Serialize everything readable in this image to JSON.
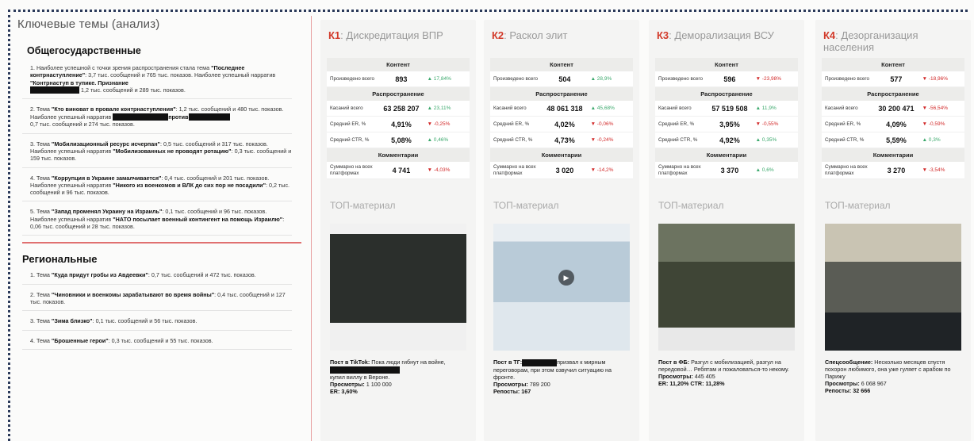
{
  "left": {
    "title": "Ключевые темы (анализ)",
    "section1": "Общегосударственные",
    "items1": [
      {
        "pre": "1. Наиболее успешной с точки зрения распространения стала тема ",
        "theme": "\"Последнее контрнаступление\"",
        "post": ": 3,7 тыс. сообщений и 765 тыс. показов. Наиболее успешный нарратив ",
        "narr": "\"Контрнаступ в тупике. Признание",
        "tail": "1,2 тыс. сообщений и 289 тыс. показов."
      },
      {
        "pre": "2. Тема ",
        "theme": "\"Кто виноват в провале контрнаступления\"",
        "post": ": 1,2 тыс. сообщений и 480 тыс. показов. Наиболее успешный нарратив ",
        "narr": "против",
        "tail": "0,7 тыс. сообщений и 274 тыс. показов."
      },
      {
        "pre": "3. Тема ",
        "theme": "\"Мобилизационный ресурс исчерпан\"",
        "post": ": 0,5 тыс. сообщений и 317 тыс. показов. Наиболее успешный нарратив ",
        "narr": "\"Мобилизованных не проводят ротацию\"",
        "tail": ": 0,3 тыс. сообщений и 159 тыс. показов."
      },
      {
        "pre": "4. Тема ",
        "theme": "\"Коррупция в Украине замалчивается\"",
        "post": ": 0,4 тыс. сообщений и 201 тыс. показов. Наиболее успешный нарратив ",
        "narr": "\"Никого из военкомов и ВЛК до сих пор не посадили\"",
        "tail": ": 0,2 тыс. сообщений и 96 тыс. показов."
      },
      {
        "pre": "5. Тема ",
        "theme": "\"Запад променял Украину на Израиль\"",
        "post": ": 0,1 тыс. сообщений и 96 тыс. показов. Наиболее успешный нарратив ",
        "narr": "\"НАТО посылает военный контингент на помощь Израилю\"",
        "tail": ": 0,06 тыс. сообщений и 28 тыс. показов."
      }
    ],
    "section2": "Региональные",
    "items2": [
      {
        "pre": "1. Тема ",
        "theme": "\"Куда придут гробы из Авдеевки\"",
        "post": ": 0,7 тыс. сообщений и 472 тыс. показов."
      },
      {
        "pre": "2. Тема ",
        "theme": "\"Чиновники и военкомы зарабатывают во время войны\"",
        "post": ": 0,4 тыс. сообщений и 127 тыс. показов."
      },
      {
        "pre": "3. Тема ",
        "theme": "\"Зима близко\"",
        "post": ": 0,1 тыс. сообщений и 56 тыс. показов."
      },
      {
        "pre": "4. Тема ",
        "theme": "\"Брошенные герои\"",
        "post": ": 0,3 тыс. сообщений и 55 тыс. показов."
      }
    ]
  },
  "labels": {
    "content": "Контент",
    "spread": "Распространение",
    "comments": "Комментарии",
    "produced": "Произведено всего",
    "reach": "Касаний всего",
    "er": "Средний ER, %",
    "ctr": "Средний CTR, %",
    "comm_total": "Суммарно на всех платформах",
    "top": "ТОП-материал"
  },
  "cards": [
    {
      "code": "К1",
      "name": ": Дискредитация ВПР",
      "produced": "893",
      "produced_chg": "▲ 17,84%",
      "reach": "63 258 207",
      "reach_chg": "▲ 23,11%",
      "er": "4,91%",
      "er_chg": "▼ -0,25%",
      "ctr": "5,08%",
      "ctr_chg": "▲ 0,46%",
      "comm": "4 741",
      "comm_chg": "▼ -4,03%",
      "cap_label": "Пост в TikTok:",
      "cap_text": " Пока люди гибнут на войне,",
      "cap_text2": "купил виллу в Вероне.",
      "views_label": "Просмотры:",
      "views": " 1 100 000",
      "extra": "ER: 3,60%"
    },
    {
      "code": "К2",
      "name": ": Раскол элит",
      "produced": "504",
      "produced_chg": "▲ 28,9%",
      "reach": "48 061 318",
      "reach_chg": "▲ 45,68%",
      "er": "4,02%",
      "er_chg": "▼ -0,06%",
      "ctr": "4,73%",
      "ctr_chg": "▼ -0,24%",
      "comm": "3 020",
      "comm_chg": "▼ -14,2%",
      "cap_label": "Пост в TГ:",
      "cap_text": "призвал к мирным переговорам, при этом озвучил ситуацию на фронте.",
      "cap_text2": "",
      "views_label": "Просмотры:",
      "views": " 789 200",
      "extra": "Репосты: 167"
    },
    {
      "code": "К3",
      "name": ": Деморализация ВСУ",
      "produced": "596",
      "produced_chg": "▼ -23,98%",
      "reach": "57 519 508",
      "reach_chg": "▲ 11,9%",
      "er": "3,95%",
      "er_chg": "▼ -0,55%",
      "ctr": "4,92%",
      "ctr_chg": "▲ 0,35%",
      "comm": "3 370",
      "comm_chg": "▲ 0,6%",
      "cap_label": "Пост в ФБ:",
      "cap_text": " Разгул с мобилизацией, разгул на передовой… Ребятам и пожаловаться-то некому.",
      "cap_text2": "",
      "views_label": "Просмотры:",
      "views": " 445 405",
      "extra": "ER: 11,20%  CTR: 11,28%"
    },
    {
      "code": "К4",
      "name": ": Дезорганизация населения",
      "produced": "577",
      "produced_chg": "▼ -18,96%",
      "reach": "30 200 471",
      "reach_chg": "▼ -56,54%",
      "er": "4,09%",
      "er_chg": "▼ -0,59%",
      "ctr": "5,59%",
      "ctr_chg": "▲ 0,3%",
      "comm": "3 270",
      "comm_chg": "▼ -3,54%",
      "cap_label": "Спецсообщение:",
      "cap_text": " Несколько месяцев спустя похорон любимого, она уже гуляет с арабом по Парижу",
      "cap_text2": "",
      "views_label": "Просмотры:",
      "views": " 6 068 967",
      "extra": "Репосты: 32 666"
    }
  ],
  "colors": {
    "accent_red": "#d23a2a",
    "up_green": "#3aa86b",
    "down_red": "#d22a2a"
  }
}
